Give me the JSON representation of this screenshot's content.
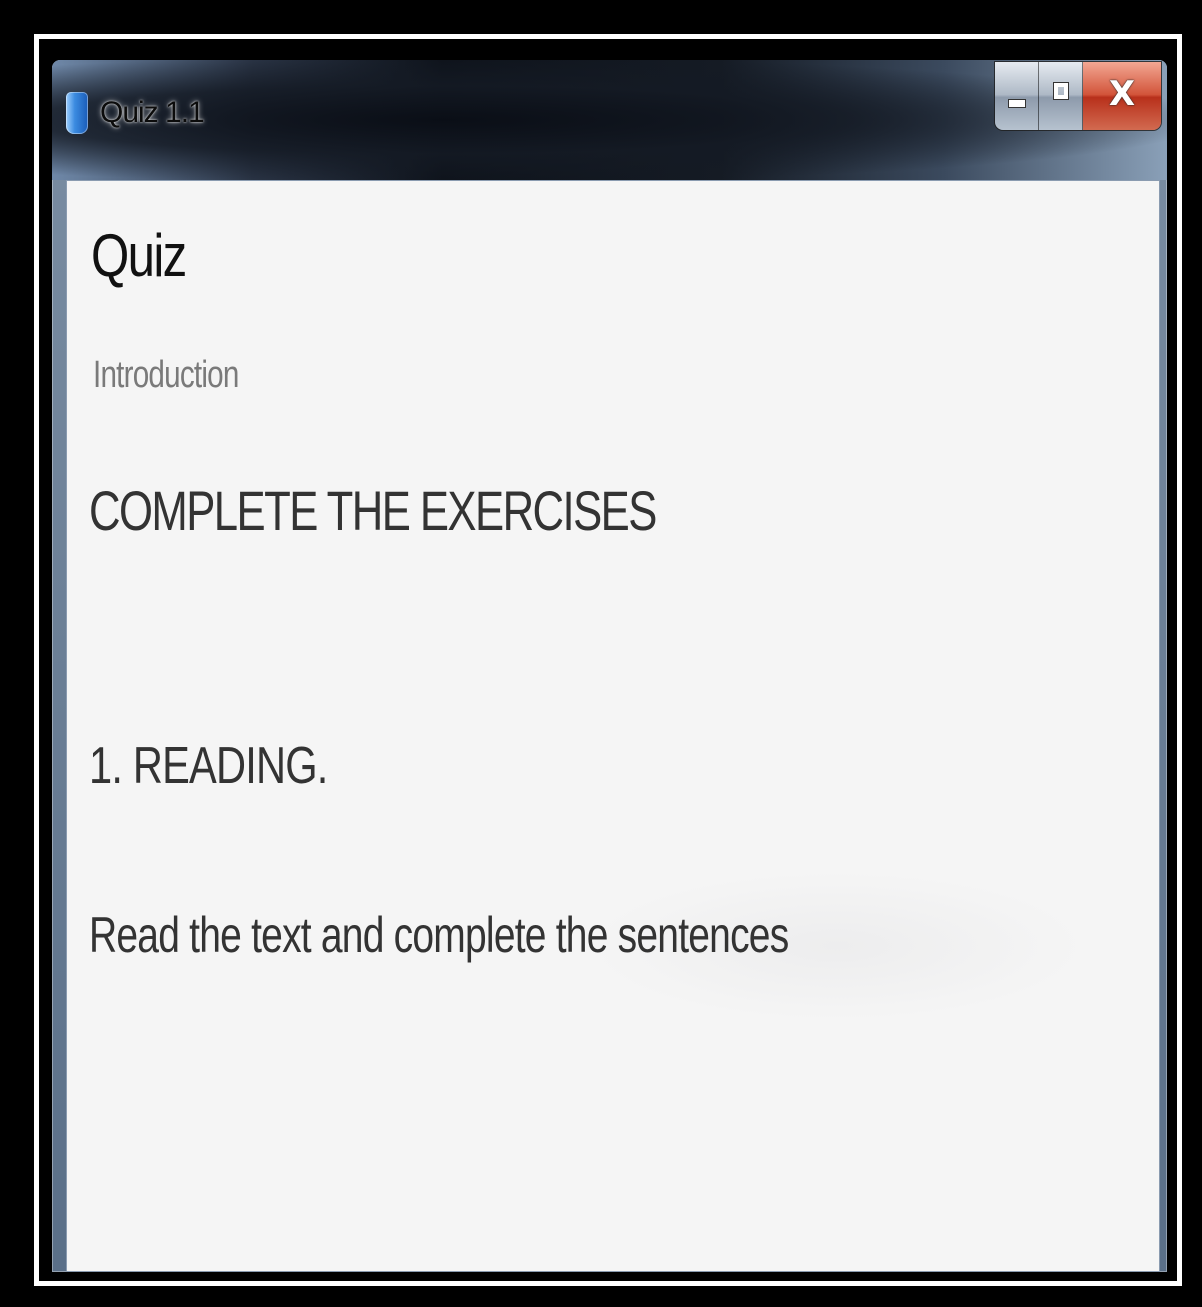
{
  "window": {
    "title": "Quiz 1.1",
    "icon": "app-cube-icon",
    "buttons": {
      "minimize_icon": "minimize-icon",
      "maximize_icon": "maximize-icon",
      "close_label": "X"
    }
  },
  "content": {
    "title": "Quiz",
    "subtitle": "Introduction",
    "heading": "COMPLETE THE EXERCISES",
    "section": "1. READING.",
    "instruction": "Read the text and complete the sentences"
  },
  "colors": {
    "client_background": "#f5f5f5",
    "close_button": "#c7432a",
    "subtitle_text": "#7a7a7a"
  }
}
